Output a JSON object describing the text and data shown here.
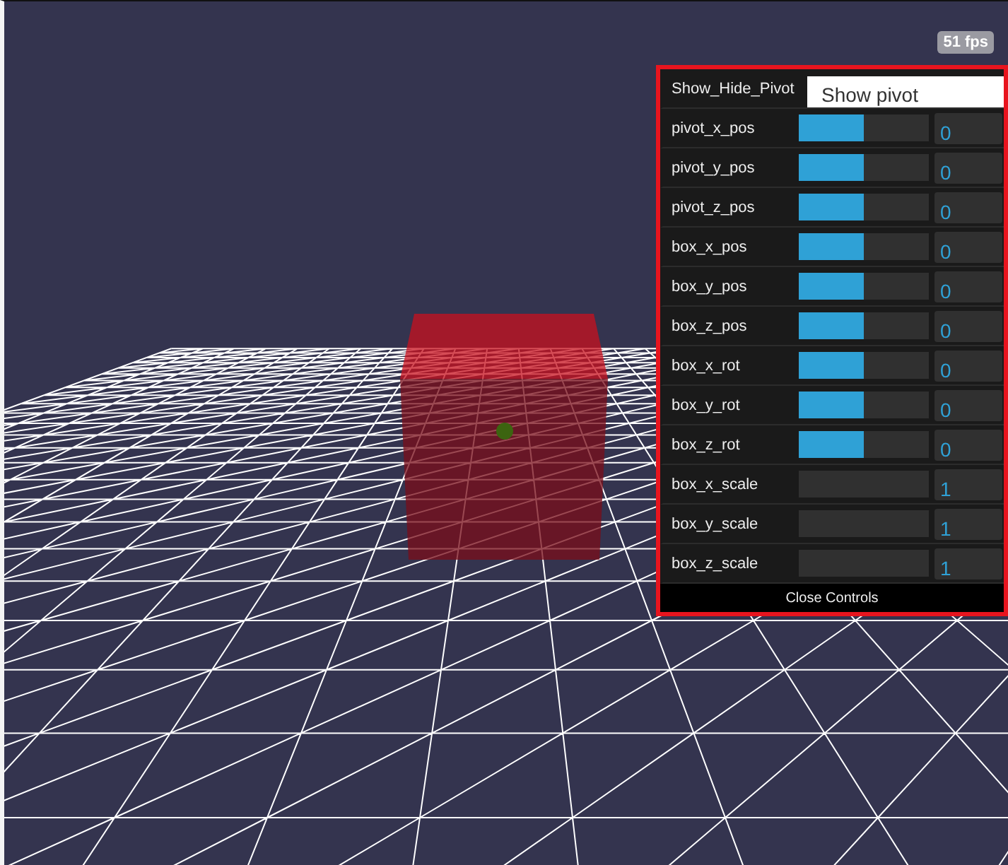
{
  "fps": "51 fps",
  "controls": [
    {
      "kind": "select",
      "label": "Show_Hide_Pivot",
      "value": "Show pivot"
    },
    {
      "kind": "slider",
      "label": "pivot_x_pos",
      "level": 0.5,
      "value": "0"
    },
    {
      "kind": "slider",
      "label": "pivot_y_pos",
      "level": 0.5,
      "value": "0"
    },
    {
      "kind": "slider",
      "label": "pivot_z_pos",
      "level": 0.5,
      "value": "0"
    },
    {
      "kind": "slider",
      "label": "box_x_pos",
      "level": 0.5,
      "value": "0"
    },
    {
      "kind": "slider",
      "label": "box_y_pos",
      "level": 0.5,
      "value": "0"
    },
    {
      "kind": "slider",
      "label": "box_z_pos",
      "level": 0.5,
      "value": "0"
    },
    {
      "kind": "slider",
      "label": "box_x_rot",
      "level": 0.5,
      "value": "0"
    },
    {
      "kind": "slider",
      "label": "box_y_rot",
      "level": 0.5,
      "value": "0"
    },
    {
      "kind": "slider",
      "label": "box_z_rot",
      "level": 0.5,
      "value": "0"
    },
    {
      "kind": "slider",
      "label": "box_x_scale",
      "level": 0,
      "value": "1"
    },
    {
      "kind": "slider",
      "label": "box_y_scale",
      "level": 0,
      "value": "1"
    },
    {
      "kind": "slider",
      "label": "box_z_scale",
      "level": 0,
      "value": "1"
    }
  ],
  "close_button": "Close Controls"
}
